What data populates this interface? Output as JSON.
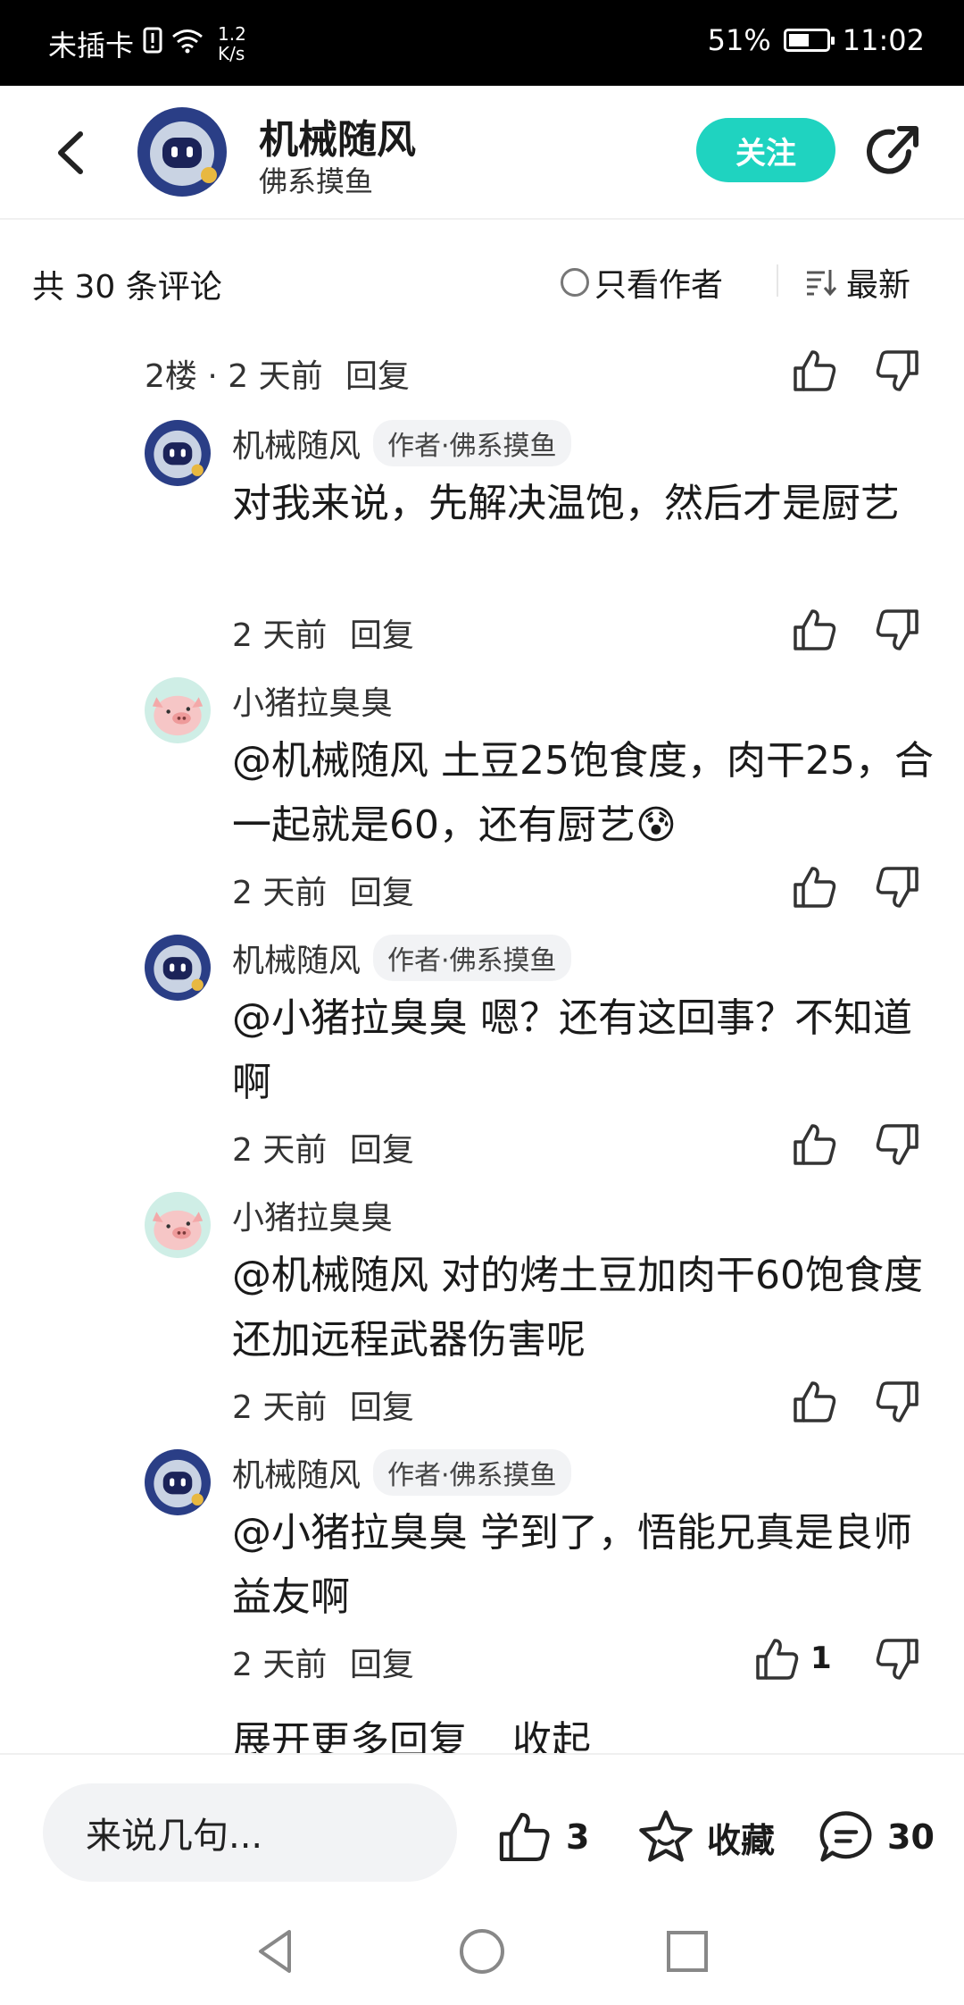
{
  "status_bar": {
    "carrier": "未插卡",
    "speed_top": "1.2",
    "speed_bottom": "K/s",
    "battery": "51%",
    "time": "11:02"
  },
  "header": {
    "name": "机械随风",
    "subtitle": "佛系摸鱼",
    "follow": "关注"
  },
  "comment_bar": {
    "count": "共 30 条评论",
    "only_author": "只看作者",
    "sort": "最新"
  },
  "floor_meta": {
    "floor": "2楼 · 2 天前",
    "reply": "回复"
  },
  "replies": [
    {
      "name": "机械随风",
      "tag": "作者·佛系摸鱼",
      "text": "对我来说，先解决温饱，然后才是厨艺",
      "time": "2 天前",
      "reply": "回复"
    },
    {
      "name": "小猪拉臭臭",
      "tag": "",
      "text": "@机械随风  土豆25饱食度，肉干25，合一起就是60，还有厨艺😰",
      "time": "2 天前",
      "reply": "回复"
    },
    {
      "name": "机械随风",
      "tag": "作者·佛系摸鱼",
      "text": "@小猪拉臭臭  嗯？还有这回事？不知道啊",
      "time": "2 天前",
      "reply": "回复"
    },
    {
      "name": "小猪拉臭臭",
      "tag": "",
      "text": "@机械随风  对的烤土豆加肉干60饱食度还加远程武器伤害呢",
      "time": "2 天前",
      "reply": "回复"
    },
    {
      "name": "机械随风",
      "tag": "作者·佛系摸鱼",
      "text": "@小猪拉臭臭  学到了，悟能兄真是良师益友啊",
      "time": "2 天前",
      "reply": "回复",
      "likes": "1"
    }
  ],
  "expand": {
    "more": "展开更多回复",
    "collapse": "收起"
  },
  "bottom_bar": {
    "placeholder": "来说几句...",
    "likes": "3",
    "favorite": "收藏",
    "comments": "30"
  },
  "icons": [
    "back-arrow-icon",
    "share-icon",
    "thumb-up-icon",
    "thumb-down-icon",
    "star-icon",
    "comment-icon",
    "sort-icon"
  ],
  "colors": {
    "accent": "#1fd3c0"
  }
}
